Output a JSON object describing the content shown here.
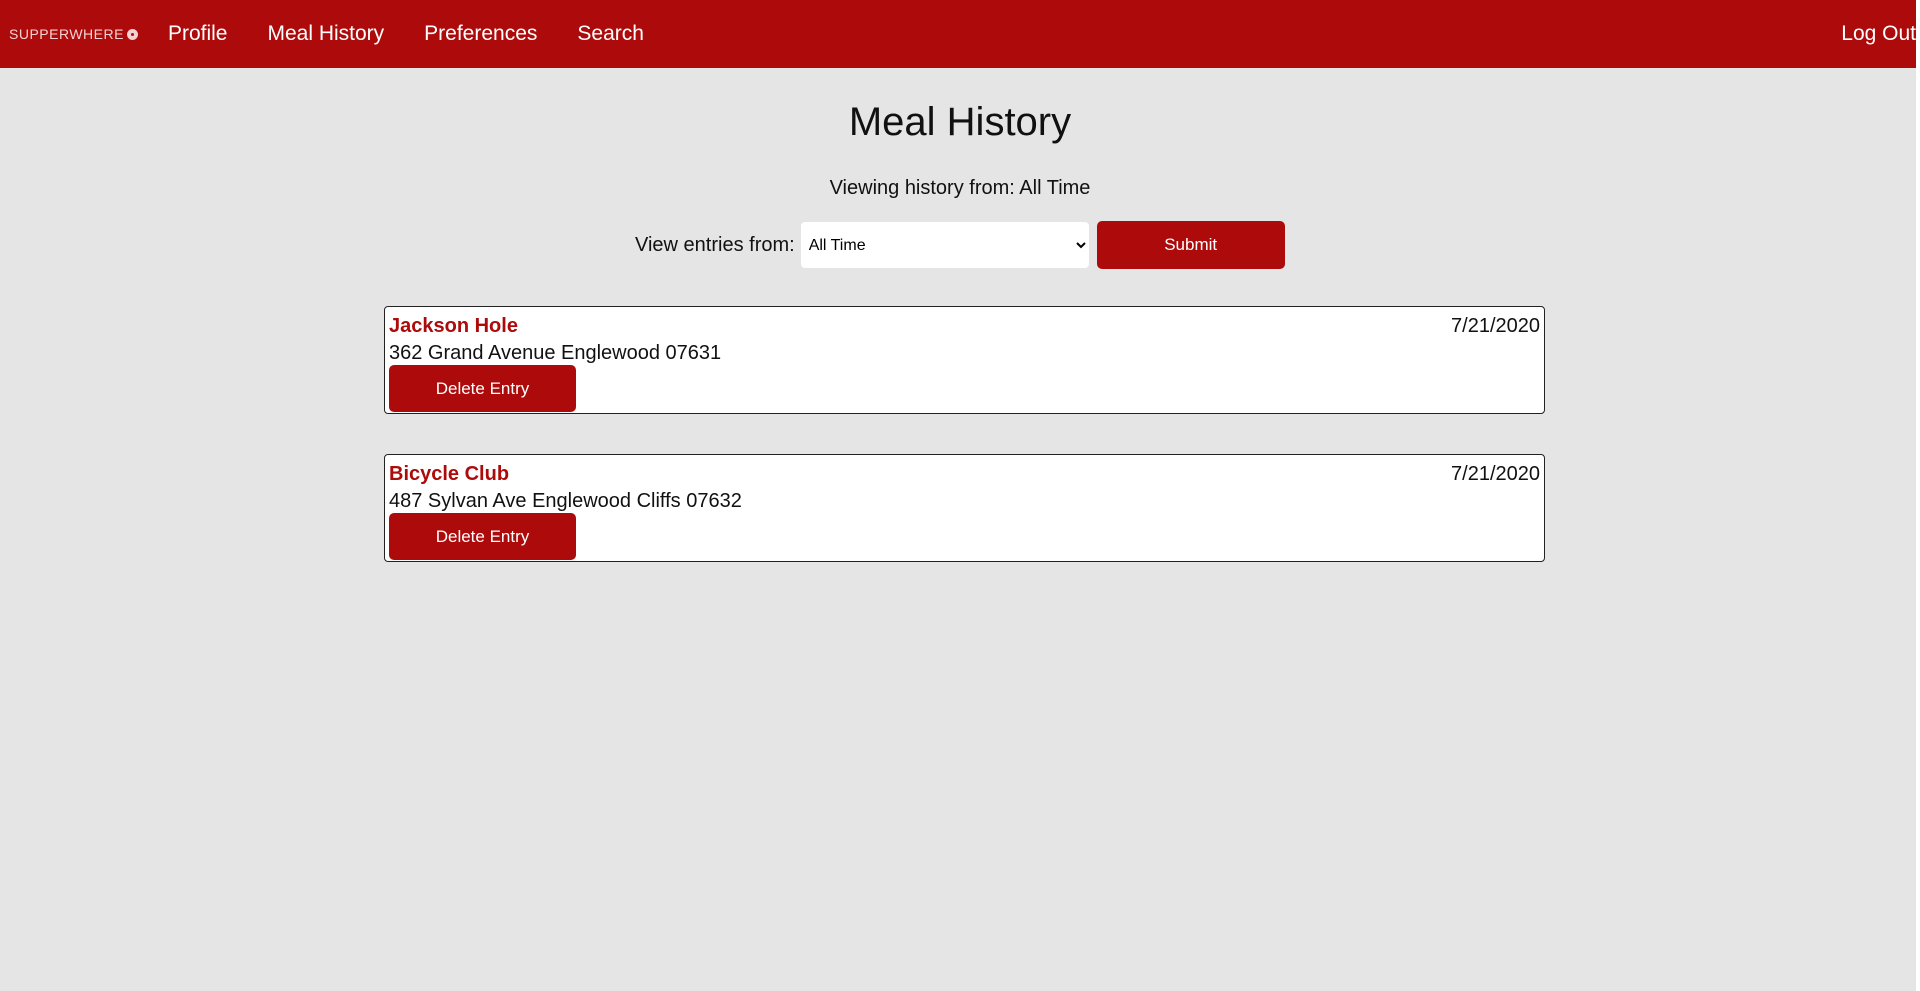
{
  "nav": {
    "brand": "SUPPERWHERE",
    "links": [
      "Profile",
      "Meal History",
      "Preferences",
      "Search"
    ],
    "logout": "Log Out"
  },
  "page": {
    "title": "Meal History",
    "viewing_prefix": "Viewing history from: ",
    "viewing_value": "All Time"
  },
  "filter": {
    "label": "View entries from:",
    "selected": "All Time",
    "submit_label": "Submit"
  },
  "entries": [
    {
      "name": "Jackson Hole",
      "address": "362 Grand Avenue Englewood 07631",
      "date": "7/21/2020",
      "delete_label": "Delete Entry"
    },
    {
      "name": "Bicycle Club",
      "address": "487 Sylvan Ave Englewood Cliffs 07632",
      "date": "7/21/2020",
      "delete_label": "Delete Entry"
    }
  ],
  "colors": {
    "accent": "#ad0b0b",
    "background": "#e5e5e5"
  }
}
